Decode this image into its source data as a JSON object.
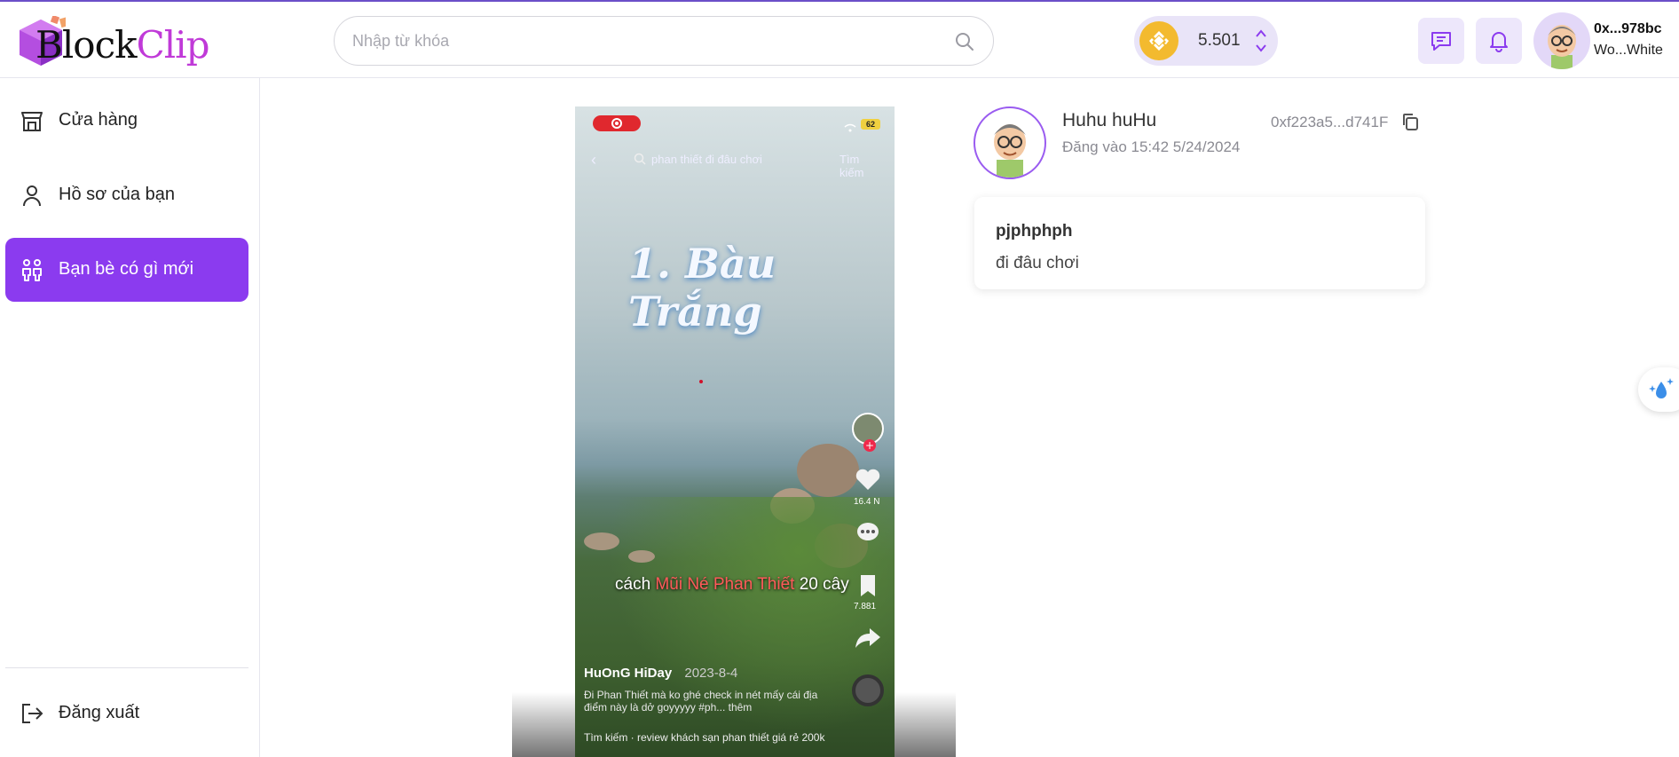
{
  "app": {
    "logo_part1": "Block",
    "logo_part2": "Clip"
  },
  "search": {
    "placeholder": "Nhập từ khóa",
    "value": ""
  },
  "wallet": {
    "balance": "5.501",
    "token_icon": "bnb-icon"
  },
  "header": {
    "message_icon": "chat-icon",
    "notification_icon": "bell-icon"
  },
  "user": {
    "address": "0x...978bc",
    "name": "Wo...White"
  },
  "sidebar": {
    "items": [
      {
        "label": "Cửa hàng",
        "icon": "store-icon"
      },
      {
        "label": "Hồ sơ của bạn",
        "icon": "user-icon"
      },
      {
        "label": "Bạn bè có gì mới",
        "icon": "friends-icon",
        "active": true
      }
    ],
    "logout_label": "Đăng xuất"
  },
  "video": {
    "search_text": "phan thiết đi đâu chơi",
    "search_button": "Tìm kiếm",
    "battery": "62",
    "title": "1. Bàu Trắng",
    "caption_prefix": "cách ",
    "caption_highlight": "Mũi Né Phan Thiết",
    "caption_suffix": " 20 cây",
    "author": "HuOnG HiDay",
    "date": "2023-8-4",
    "description": "Đi Phan Thiết mà ko ghé check in nét mấy cái địa điểm này là dở goyyyyy #ph... thêm",
    "footer": "Tìm kiếm · review khách sạn phan thiết giá rẻ 200k",
    "likes": "16.4 N",
    "saves": "7.881"
  },
  "post": {
    "author": "Huhu huHu",
    "posted_at": "Đăng vào 15:42 5/24/2024",
    "address": "0xf223a5...d741F",
    "title": "pjphphph",
    "text": "đi đâu chơi"
  },
  "colors": {
    "accent": "#8b3bef",
    "brand_pink": "#c03ad8",
    "bnb": "#f3ba2f"
  }
}
